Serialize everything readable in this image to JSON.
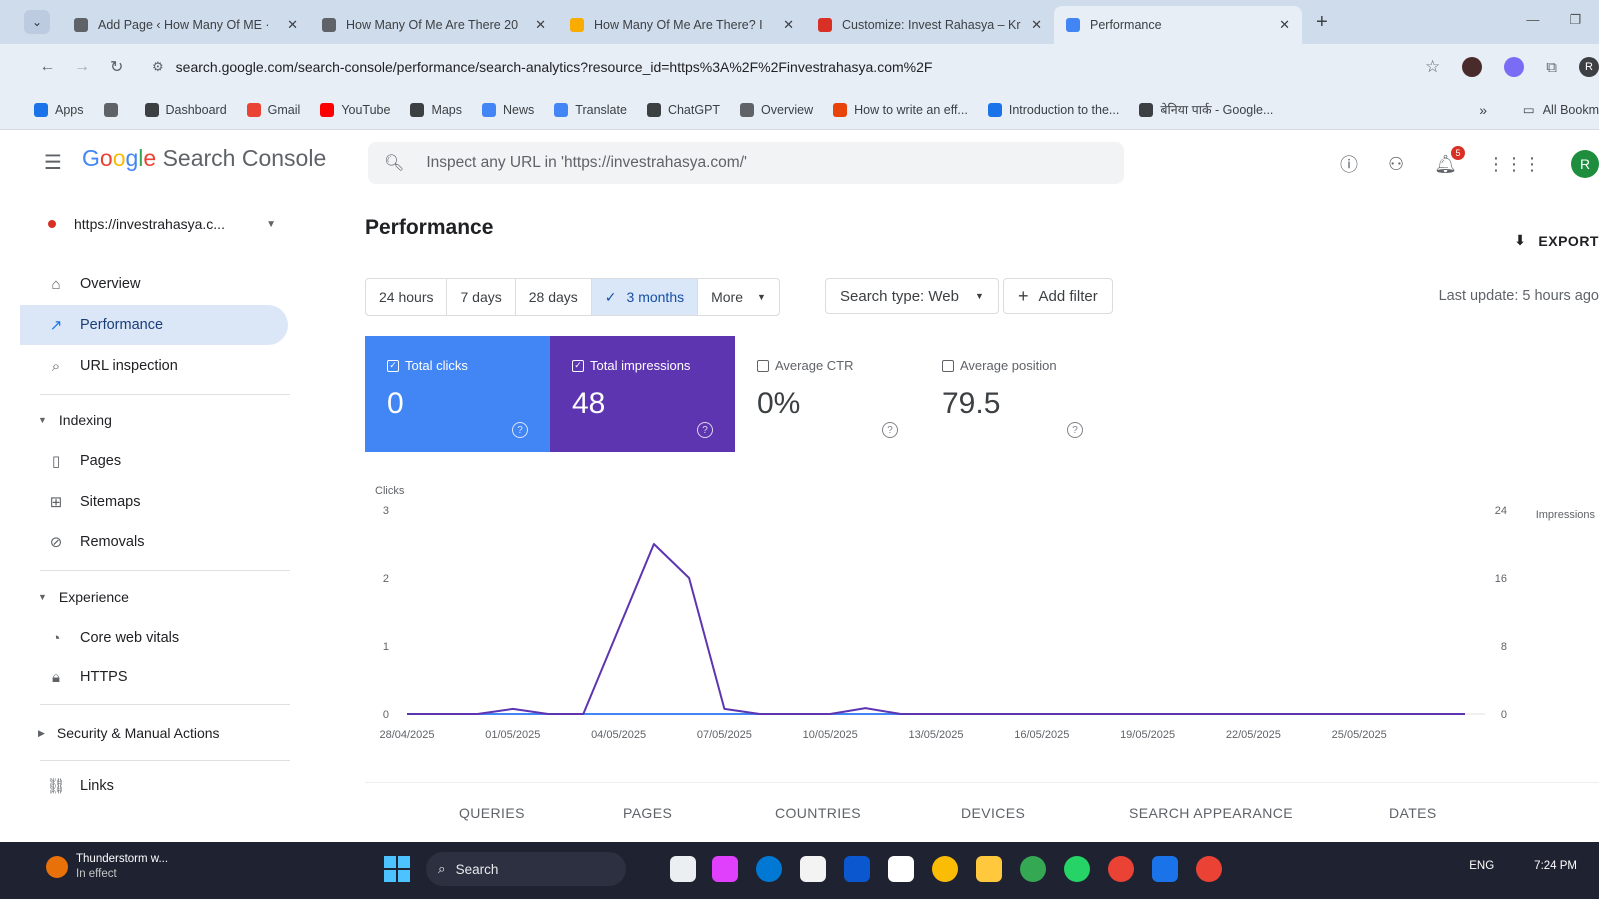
{
  "browser": {
    "tabs": [
      {
        "title": "Add Page ‹ How Many Of ME ·",
        "favicon_color": "#5f6368"
      },
      {
        "title": "How Many Of Me Are There 20",
        "favicon_color": "#5f6368"
      },
      {
        "title": "How Many Of Me Are There? I",
        "favicon_color": "#f9ab00"
      },
      {
        "title": "Customize: Invest Rahasya – Kr",
        "favicon_color": "#d93025"
      },
      {
        "title": "Performance",
        "favicon_color": "#4285f4",
        "active": true
      }
    ],
    "url": "search.google.com/search-console/performance/search-analytics?resource_id=https%3A%2F%2Finvestrahasya.com%2F",
    "profile_initial": "R",
    "bookmarks": [
      {
        "label": "Apps",
        "icon": "apps-grid-icon"
      },
      {
        "label": "",
        "icon": "grid-icon"
      },
      {
        "label": "Dashboard",
        "icon": "globe-icon"
      },
      {
        "label": "Gmail",
        "icon": "gmail-icon"
      },
      {
        "label": "YouTube",
        "icon": "youtube-icon"
      },
      {
        "label": "Maps",
        "icon": "globe-icon"
      },
      {
        "label": "News",
        "icon": "news-icon"
      },
      {
        "label": "Translate",
        "icon": "translate-icon"
      },
      {
        "label": "ChatGPT",
        "icon": "chatgpt-icon"
      },
      {
        "label": "Overview",
        "icon": "overview-icon"
      },
      {
        "label": "How to write an eff...",
        "icon": "bookmark-orange-icon"
      },
      {
        "label": "Introduction to the...",
        "icon": "bookmark-blue-icon"
      },
      {
        "label": "बेनिया पार्क - Google...",
        "icon": "globe-icon"
      }
    ],
    "bookmarks_more": "»",
    "all_bookmarks": "All Bookm"
  },
  "header": {
    "brand_google": "Google",
    "brand_product": "Search Console",
    "inspect_placeholder": "Inspect any URL in 'https://investrahasya.com/'",
    "notification_count": "5",
    "account_initial": "R"
  },
  "sidebar": {
    "property": "https://investrahasya.c...",
    "items": [
      {
        "label": "Overview",
        "icon": "home-icon"
      },
      {
        "label": "Performance",
        "icon": "trending-up-icon",
        "active": true
      },
      {
        "label": "URL inspection",
        "icon": "search-icon"
      }
    ],
    "indexing": {
      "title": "Indexing",
      "items": [
        {
          "label": "Pages",
          "icon": "pages-icon"
        },
        {
          "label": "Sitemaps",
          "icon": "sitemap-icon"
        },
        {
          "label": "Removals",
          "icon": "removals-icon"
        }
      ]
    },
    "experience": {
      "title": "Experience",
      "items": [
        {
          "label": "Core web vitals",
          "icon": "speed-icon"
        },
        {
          "label": "HTTPS",
          "icon": "lock-icon"
        }
      ]
    },
    "security": {
      "title": "Security & Manual Actions"
    },
    "links": {
      "label": "Links",
      "icon": "links-icon"
    }
  },
  "main": {
    "title": "Performance",
    "export_label": "EXPORT",
    "date_ranges": [
      "24 hours",
      "7 days",
      "28 days",
      "3 months",
      "More"
    ],
    "selected_range": "3 months",
    "search_type": "Search type: Web",
    "add_filter": "Add filter",
    "last_update": "Last update: 5 hours ago",
    "metrics": [
      {
        "label": "Total clicks",
        "value": "0",
        "checked": true
      },
      {
        "label": "Total impressions",
        "value": "48",
        "checked": true
      },
      {
        "label": "Average CTR",
        "value": "0%",
        "checked": false
      },
      {
        "label": "Average position",
        "value": "79.5",
        "checked": false
      }
    ],
    "tabs": [
      "QUERIES",
      "PAGES",
      "COUNTRIES",
      "DEVICES",
      "SEARCH APPEARANCE",
      "DATES"
    ]
  },
  "chart_data": {
    "type": "line",
    "ylabel_left": "Clicks",
    "ylabel_right": "Impressions",
    "yticks_left": [
      "3",
      "2",
      "1",
      "0"
    ],
    "yticks_right": [
      "24",
      "16",
      "8",
      "0"
    ],
    "ylim_left": [
      0,
      3
    ],
    "ylim_right": [
      0,
      24
    ],
    "x_tick_labels": [
      "28/04/2025",
      "01/05/2025",
      "04/05/2025",
      "07/05/2025",
      "10/05/2025",
      "13/05/2025",
      "16/05/2025",
      "19/05/2025",
      "22/05/2025",
      "25/05/2025"
    ],
    "x_range": [
      "28/04/2025",
      "28/05/2025"
    ],
    "series": [
      {
        "name": "Clicks",
        "axis": "left",
        "color": "#4285f4",
        "points": [
          [
            "28/04/2025",
            0
          ],
          [
            "28/05/2025",
            0
          ]
        ]
      },
      {
        "name": "Impressions",
        "axis": "right",
        "color": "#5e35b1",
        "points": [
          [
            "28/04/2025",
            0
          ],
          [
            "30/04/2025",
            0
          ],
          [
            "01/05/2025",
            0.6
          ],
          [
            "02/05/2025",
            0
          ],
          [
            "03/05/2025",
            0
          ],
          [
            "05/05/2025",
            20
          ],
          [
            "06/05/2025",
            16
          ],
          [
            "07/05/2025",
            0.6
          ],
          [
            "08/05/2025",
            0
          ],
          [
            "09/05/2025",
            0
          ],
          [
            "10/05/2025",
            0
          ],
          [
            "11/05/2025",
            0.7
          ],
          [
            "12/05/2025",
            0
          ],
          [
            "28/05/2025",
            0
          ]
        ]
      }
    ]
  },
  "taskbar": {
    "weather_title": "Thunderstorm w...",
    "weather_sub": "In effect",
    "search_label": "Search",
    "lang": "ENG",
    "time": "7:24 PM"
  }
}
